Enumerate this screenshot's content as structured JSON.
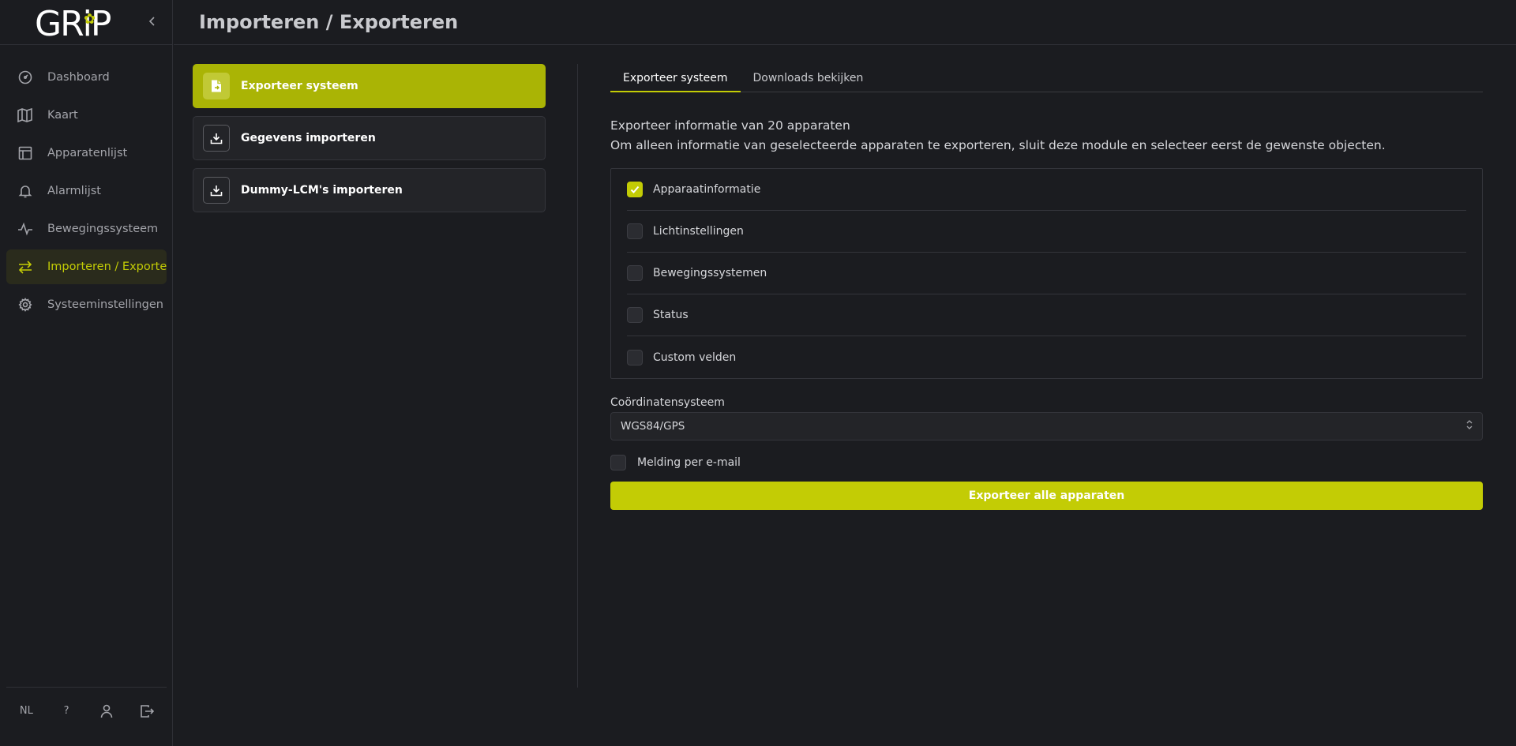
{
  "app": {
    "logo_text": "GRiP"
  },
  "sidebar": {
    "items": [
      {
        "label": "Dashboard",
        "icon": "dashboard-icon"
      },
      {
        "label": "Kaart",
        "icon": "map-icon"
      },
      {
        "label": "Apparatenlijst",
        "icon": "table-icon"
      },
      {
        "label": "Alarmlijst",
        "icon": "bell-icon"
      },
      {
        "label": "Bewegingssysteem",
        "icon": "activity-icon"
      },
      {
        "label": "Importeren / Exportere",
        "icon": "arrows-swap-icon",
        "active": true
      },
      {
        "label": "Systeeminstellingen",
        "icon": "gear-icon"
      }
    ],
    "footer": {
      "language": "NL",
      "help": "?"
    }
  },
  "header": {
    "title": "Importeren / Exporteren"
  },
  "menu": {
    "items": [
      {
        "label": "Exporteer systeem",
        "icon": "file-export-icon",
        "active": true
      },
      {
        "label": "Gegevens importeren",
        "icon": "download-icon"
      },
      {
        "label": "Dummy-LCM's importeren",
        "icon": "download-icon"
      }
    ]
  },
  "tabs": [
    {
      "label": "Exporteer systeem",
      "active": true
    },
    {
      "label": "Downloads bekijken"
    }
  ],
  "info": {
    "line1": "Exporteer informatie van 20 apparaten",
    "line2": "Om alleen informatie van geselecteerde apparaten te exporteren, sluit deze module en selecteer eerst de gewenste objecten."
  },
  "options": [
    {
      "label": "Apparaatinformatie",
      "checked": true
    },
    {
      "label": "Lichtinstellingen",
      "checked": false
    },
    {
      "label": "Bewegingssystemen",
      "checked": false
    },
    {
      "label": "Status",
      "checked": false
    },
    {
      "label": "Custom velden",
      "checked": false
    }
  ],
  "coordinates": {
    "label": "Coördinatensysteem",
    "value": "WGS84/GPS"
  },
  "email": {
    "label": "Melding per e-mail",
    "checked": false
  },
  "export_button": {
    "label": "Exporteer alle apparaten"
  },
  "colors": {
    "accent": "#c3cc05",
    "accent_dark": "#aab405",
    "background": "#1b1c20",
    "panel": "#232428"
  }
}
